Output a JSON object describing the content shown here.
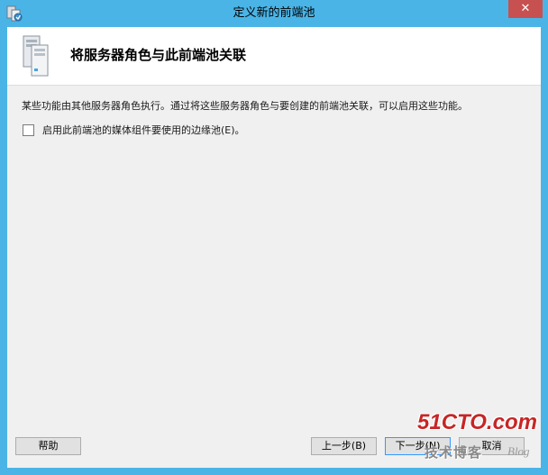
{
  "window": {
    "title": "定义新的前端池",
    "close_glyph": "✕"
  },
  "header": {
    "title": "将服务器角色与此前端池关联",
    "icon": "server-stack-icon"
  },
  "main": {
    "description": "某些功能由其他服务器角色执行。通过将这些服务器角色与要创建的前端池关联，可以启用这些功能。",
    "checkbox": {
      "label": "启用此前端池的媒体组件要使用的边缘池(E)。",
      "checked": false
    }
  },
  "buttons": {
    "help": "帮助",
    "back": "上一步(B)",
    "next": "下一步(N)",
    "cancel": "取消"
  },
  "watermark": {
    "main": "51CTO.com",
    "sub": "技术博客",
    "blog": "Blog"
  },
  "colors": {
    "frame": "#4ab4e6",
    "close": "#c75050",
    "client": "#f0f0f0",
    "watermark_red": "#c62626"
  }
}
